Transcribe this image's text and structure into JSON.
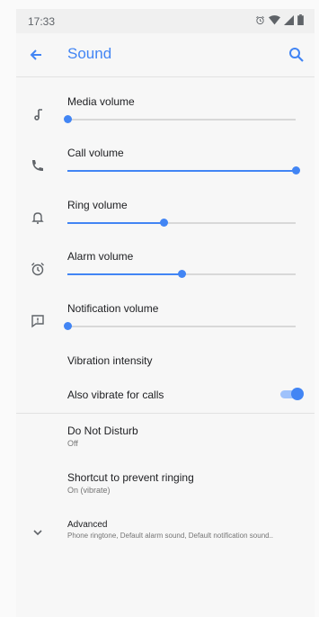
{
  "status_bar": {
    "time": "17:33",
    "icons": [
      "alarm-icon",
      "wifi-icon",
      "signal-icon",
      "battery-icon"
    ]
  },
  "app_bar": {
    "title": "Sound",
    "back_icon": "arrow-back-icon",
    "search_icon": "search-icon"
  },
  "colors": {
    "accent": "#4285f4",
    "track": "#d8d8d8",
    "toggle_track": "#9fc2fb"
  },
  "volumes": [
    {
      "label": "Media volume",
      "icon": "music-note-icon",
      "level": 0.0
    },
    {
      "label": "Call volume",
      "icon": "phone-icon",
      "level": 1.0
    },
    {
      "label": "Ring volume",
      "icon": "bell-icon",
      "level": 0.42
    },
    {
      "label": "Alarm volume",
      "icon": "alarm-clock-icon",
      "level": 0.5
    },
    {
      "label": "Notification volume",
      "icon": "notification-icon",
      "level": 0.0
    }
  ],
  "vibration": {
    "label": "Vibration intensity"
  },
  "also_vibrate": {
    "label": "Also vibrate for calls",
    "enabled": true
  },
  "settings": [
    {
      "title": "Do Not Disturb",
      "subtitle": "Off"
    },
    {
      "title": "Shortcut to prevent ringing",
      "subtitle": "On (vibrate)"
    },
    {
      "title": "Advanced",
      "subtitle": "Phone ringtone, Default alarm sound, Default notification sound..",
      "icon": "chevron-down-icon"
    }
  ]
}
